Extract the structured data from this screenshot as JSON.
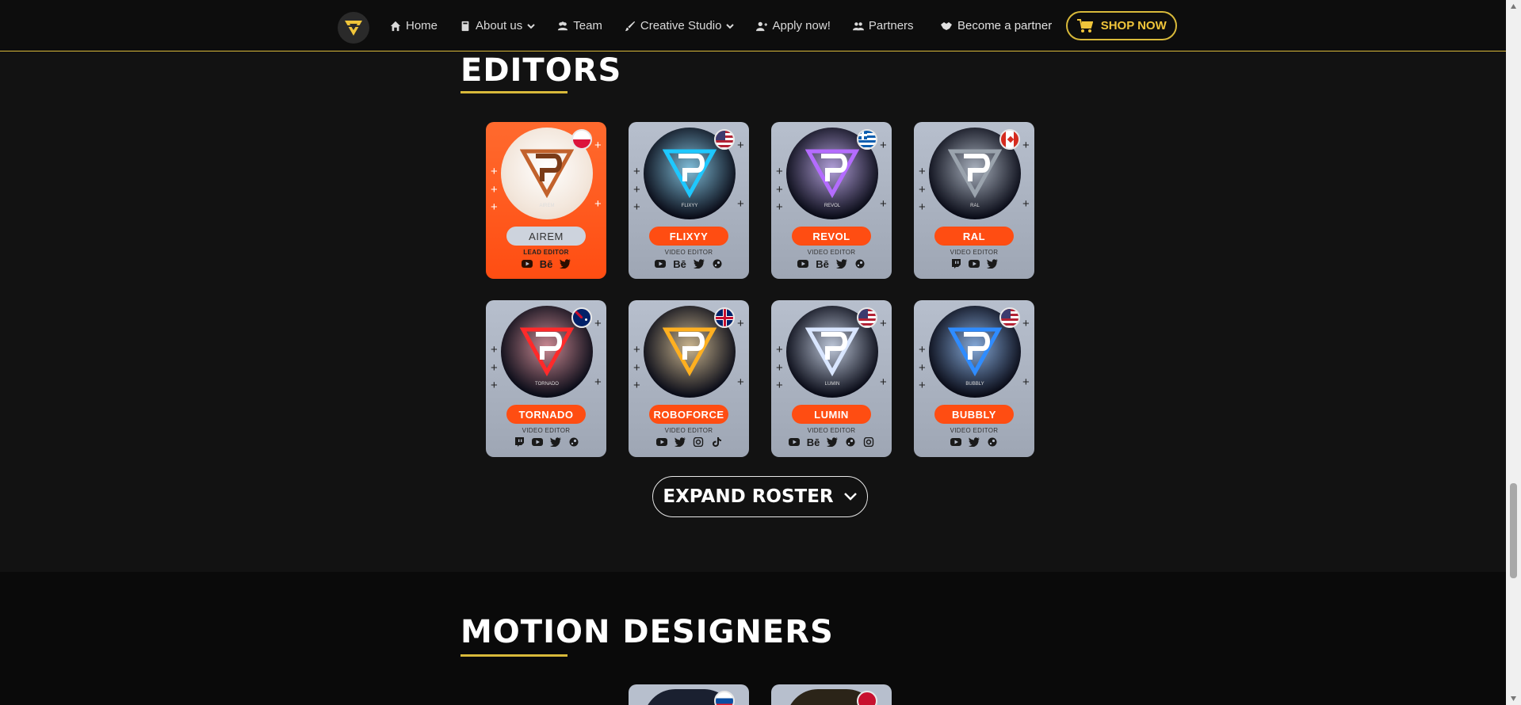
{
  "nav": {
    "items": [
      {
        "label": "Home",
        "icon": "home-icon",
        "dropdown": false
      },
      {
        "label": "About us",
        "icon": "book-icon",
        "dropdown": true
      },
      {
        "label": "Team",
        "icon": "team-icon",
        "dropdown": false
      },
      {
        "label": "Creative Studio",
        "icon": "brush-icon",
        "dropdown": true
      },
      {
        "label": "Apply now!",
        "icon": "user-plus-icon",
        "dropdown": false
      },
      {
        "label": "Partners",
        "icon": "users-icon",
        "dropdown": false
      }
    ],
    "partner_label": "Become a partner",
    "shop_label": "SHOP NOW"
  },
  "editors": {
    "title": "EDITORS",
    "cards": [
      {
        "name": "AIREM",
        "role": "LEAD EDITOR",
        "lead": true,
        "flag": "poland",
        "logo_label": "AIREM",
        "socials": [
          "youtube",
          "behance",
          "twitter"
        ],
        "accent": "#ff5a1f"
      },
      {
        "name": "FLIXYY",
        "role": "VIDEO EDITOR",
        "lead": false,
        "flag": "usa",
        "logo_label": "FLIXYY",
        "socials": [
          "youtube",
          "behance",
          "twitter",
          "steam"
        ],
        "accent": "#1ec8ff"
      },
      {
        "name": "REVOL",
        "role": "VIDEO EDITOR",
        "lead": false,
        "flag": "greece",
        "logo_label": "REVOL",
        "socials": [
          "youtube",
          "behance",
          "twitter",
          "steam"
        ],
        "accent": "#b46cff"
      },
      {
        "name": "RAL",
        "role": "VIDEO EDITOR",
        "lead": false,
        "flag": "canada",
        "logo_label": "RAL",
        "socials": [
          "twitch",
          "youtube",
          "twitter"
        ],
        "accent": "#9aa3ad"
      },
      {
        "name": "TORNADO",
        "role": "VIDEO EDITOR",
        "lead": false,
        "flag": "australia",
        "logo_label": "TORNADO",
        "socials": [
          "twitch",
          "youtube",
          "twitter",
          "steam"
        ],
        "accent": "#ff2a2a"
      },
      {
        "name": "ROBOFORCE",
        "role": "VIDEO EDITOR",
        "lead": false,
        "flag": "uk",
        "logo_label": "",
        "socials": [
          "youtube",
          "twitter",
          "instagram",
          "tiktok"
        ],
        "accent": "#ffb020"
      },
      {
        "name": "LUMIN",
        "role": "VIDEO EDITOR",
        "lead": false,
        "flag": "usa",
        "logo_label": "LUMIN",
        "socials": [
          "youtube",
          "behance",
          "twitter",
          "steam",
          "instagram"
        ],
        "accent": "#d9e6ff"
      },
      {
        "name": "BUBBLY",
        "role": "VIDEO EDITOR",
        "lead": false,
        "flag": "usa",
        "logo_label": "BUBBLY",
        "socials": [
          "youtube",
          "twitter",
          "steam"
        ],
        "accent": "#2f8cff"
      }
    ],
    "expand_label": "EXPAND ROSTER"
  },
  "motion": {
    "title": "MOTION DESIGNERS"
  }
}
